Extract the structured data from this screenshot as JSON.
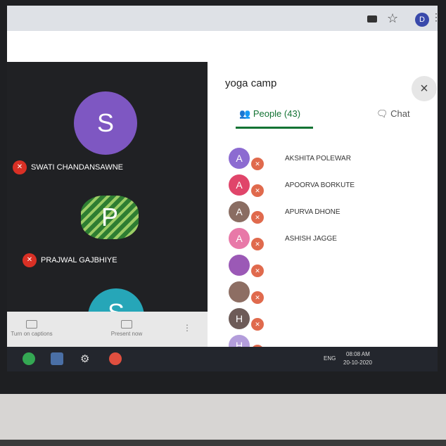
{
  "browser": {
    "profile_initial": "D"
  },
  "video": {
    "tiles": [
      {
        "initial": "S",
        "name": "SWATI CHANDANSAWNE",
        "color": "#7e57c2"
      },
      {
        "initial": "P",
        "name": "PRAJWAL GAJBHIYE",
        "color": "#3b8f3b"
      },
      {
        "initial": "S",
        "name": "",
        "color": "#26a6b8"
      }
    ],
    "toolbar": {
      "captions_label": "Turn on captions",
      "present_label": "Present now"
    }
  },
  "panel": {
    "meeting_title": "yoga camp",
    "close_label": "×",
    "tabs": {
      "people_label": "People (43)",
      "chat_label": "Chat"
    },
    "people": [
      {
        "initial": "A",
        "name": "AKSHITA POLEWAR",
        "color": "#8c6bd1"
      },
      {
        "initial": "A",
        "name": "APOORVA BORKUTE",
        "color": "#e0456a"
      },
      {
        "initial": "A",
        "name": "APURVA DHONE",
        "color": "#8a6d62"
      },
      {
        "initial": "A",
        "name": "ASHISH JAGGE",
        "color": "#e879a8"
      },
      {
        "initial": "",
        "name": "",
        "color": "#9b59b6"
      },
      {
        "initial": "",
        "name": "",
        "color": "#8d6e63"
      },
      {
        "initial": "H",
        "name": "",
        "color": "#6d5b58"
      },
      {
        "initial": "H",
        "name": "",
        "color": "#b39ddb"
      }
    ]
  },
  "taskbar": {
    "time": "08:08 AM",
    "date": "20-10-2020",
    "lang": "ENG"
  }
}
